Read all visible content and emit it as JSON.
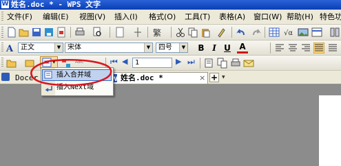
{
  "window": {
    "title": "姓名.doc * - WPS 文字",
    "app_icon_letter": "W"
  },
  "menubar": {
    "items": [
      "文件(F)",
      "编辑(E)",
      "视图(V)",
      "插入(I)",
      "格式(O)",
      "工具(T)",
      "表格(A)",
      "窗口(W)",
      "帮助(H)",
      "特色功"
    ]
  },
  "format_toolbar": {
    "style": "正文",
    "font": "宋体",
    "size": "四号",
    "bold": "B",
    "italic": "I",
    "underline": "U",
    "font_color": "A"
  },
  "mailmerge_toolbar": {
    "record_number": "1",
    "abc_label": "ABC"
  },
  "dropdown_menu": {
    "items": [
      "插入合并域",
      "插入Next域"
    ],
    "highlighted": "插入合并域"
  },
  "tabs": {
    "docer_label": "Docer",
    "active_doc": "姓名.doc *",
    "close_symbol": "×",
    "add_symbol": "+"
  },
  "colors": {
    "annotation_circle": "#d8171f",
    "title_bar": "#1346b8",
    "menu_highlight": "#c1d2ee"
  }
}
